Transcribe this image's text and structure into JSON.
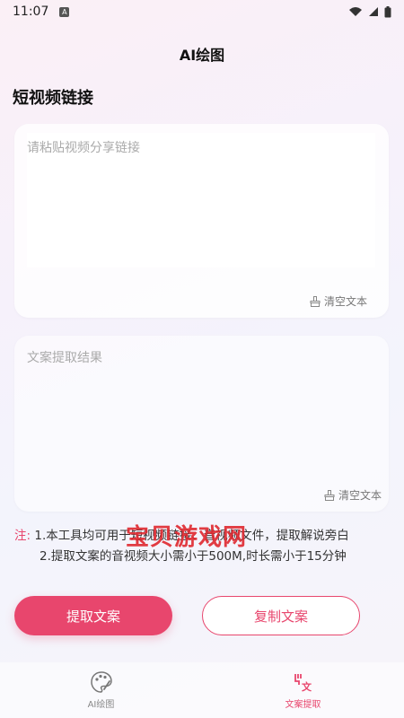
{
  "status_bar": {
    "time": "11:07",
    "notification_badge": "A"
  },
  "header": {
    "title": "AI绘图"
  },
  "section": {
    "title": "短视频链接"
  },
  "link_card": {
    "placeholder": "请粘贴视频分享链接",
    "clear_label": "清空文本"
  },
  "result_card": {
    "placeholder": "文案提取结果",
    "clear_label": "清空文本"
  },
  "note": {
    "label": "注:",
    "line1": "1.本工具均可用于短视频链接、音视频文件，提取解说旁白",
    "line2": "2.提取文案的音视频大小需小于500M,时长需小于15分钟"
  },
  "watermark": "宝贝游戏网",
  "actions": {
    "extract_label": "提取文案",
    "copy_label": "复制文案"
  },
  "tabs": [
    {
      "label": "AI绘图",
      "icon": "palette-icon",
      "active": false
    },
    {
      "label": "文案提取",
      "icon": "text-extract-icon",
      "active": true
    }
  ],
  "colors": {
    "accent": "#e8466d",
    "watermark": "#e0282e"
  }
}
